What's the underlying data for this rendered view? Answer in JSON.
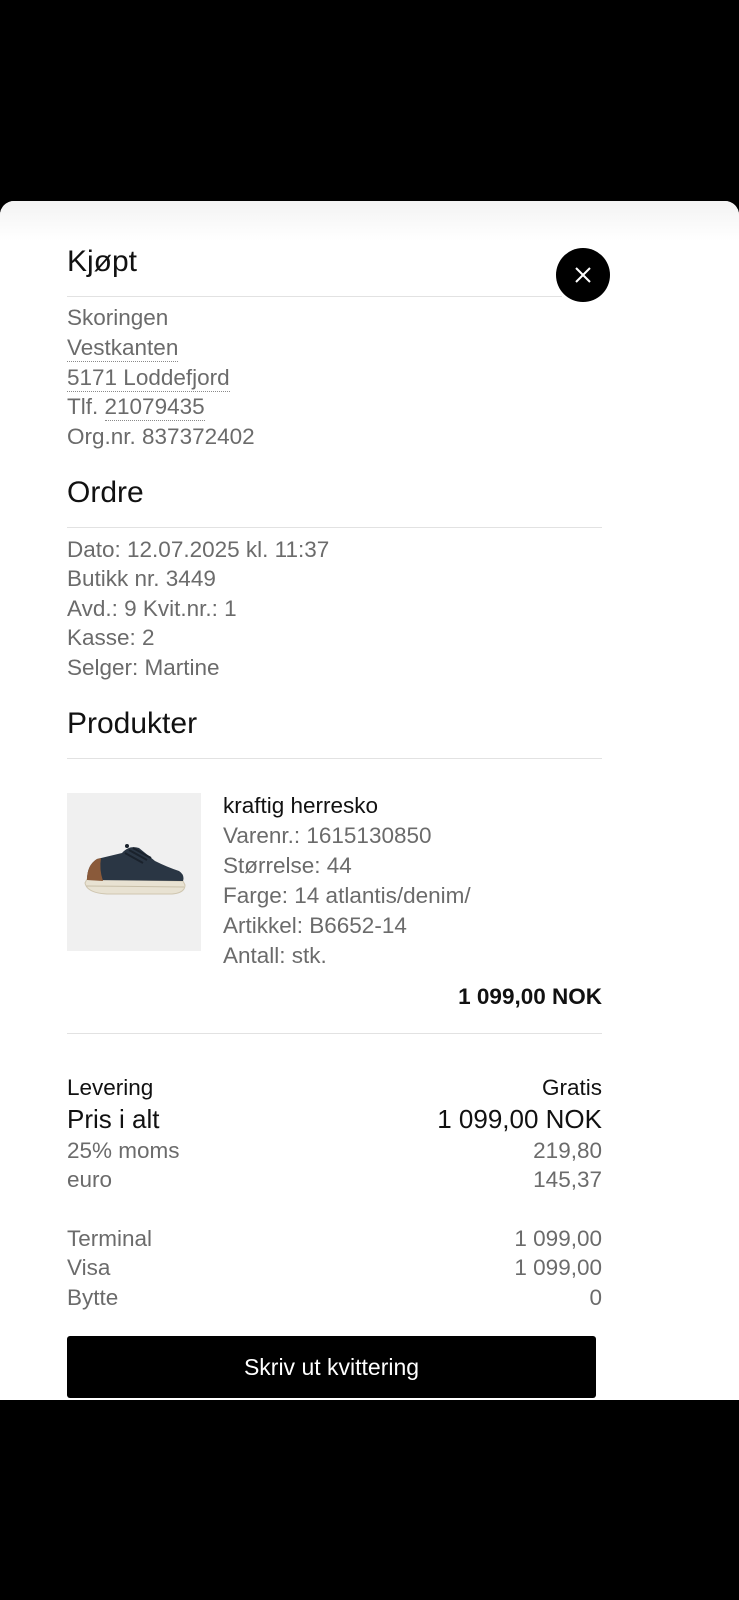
{
  "purchase": {
    "title": "Kjøpt",
    "store_name": "Skoringen",
    "address_line1": "Vestkanten",
    "address_line2": "5171 Loddefjord",
    "phone_prefix": "Tlf.",
    "phone_number": "21079435",
    "org_number": "Org.nr. 837372402"
  },
  "order": {
    "title": "Ordre",
    "date": "Dato: 12.07.2025 kl. 11:37",
    "store_number": "Butikk nr. 3449",
    "department_receipt": "Avd.: 9 Kvit.nr.: 1",
    "register": "Kasse: 2",
    "seller": "Selger: Martine"
  },
  "products": {
    "title": "Produkter",
    "items": [
      {
        "name": "kraftig herresko",
        "item_number": "Varenr.: 1615130850",
        "size": "Størrelse: 44",
        "color": "Farge: 14 atlantis/denim/",
        "article": "Artikkel: B6652-14",
        "quantity": "Antall: stk.",
        "price": "1 099,00 NOK",
        "image_icon": "shoe-image"
      }
    ]
  },
  "summary": {
    "delivery_label": "Levering",
    "delivery_value": "Gratis",
    "total_label": "Pris i alt",
    "total_value": "1 099,00 NOK",
    "vat_label": "25% moms",
    "vat_value": "219,80",
    "euro_label": "euro",
    "euro_value": "145,37"
  },
  "payment": {
    "terminal_label": "Terminal",
    "terminal_value": "1 099,00",
    "visa_label": "Visa",
    "visa_value": "1 099,00",
    "exchange_label": "Bytte",
    "exchange_value": "0"
  },
  "actions": {
    "print_label": "Skriv ut kvittering",
    "close_icon": "close-icon"
  },
  "colors": {
    "text_primary": "#111111",
    "text_secondary": "#6b6b6b",
    "button_bg": "#000000",
    "button_text": "#ffffff"
  }
}
